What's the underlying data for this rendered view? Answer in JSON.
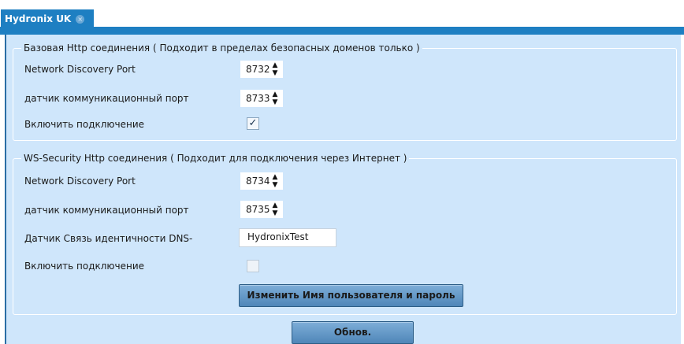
{
  "tab": {
    "title": "Hydronix UK",
    "close_symbol": "×"
  },
  "basic_http": {
    "legend": "Базовая Http соединения ( Подходит в пределах безопасных доменов только )",
    "discovery_port_label": "Network Discovery Port",
    "discovery_port_value": "8732",
    "sensor_port_label": "датчик коммуникационный порт",
    "sensor_port_value": "8733",
    "enable_label": "Включить подключение",
    "enable_checked": true,
    "check_mark": "✓"
  },
  "ws_security": {
    "legend": "WS-Security Http соединения ( Подходит для подключения через Интернет )",
    "discovery_port_label": "Network Discovery Port",
    "discovery_port_value": "8734",
    "sensor_port_label": "датчик коммуникационный порт",
    "sensor_port_value": "8735",
    "dns_identity_label": "Датчик Связь идентичности DNS-",
    "dns_identity_value": "HydronixTest",
    "enable_label": "Включить подключение",
    "enable_checked": false,
    "change_credentials_label": "Изменить Имя пользователя и пароль"
  },
  "update_button_label": "Обнов.",
  "colors": {
    "accent": "#1e7fc2",
    "panel": "#cfe6fb",
    "button": "#4f86b8"
  },
  "icons": {
    "spin_up": "up-arrow-icon",
    "spin_down": "down-arrow-icon"
  }
}
